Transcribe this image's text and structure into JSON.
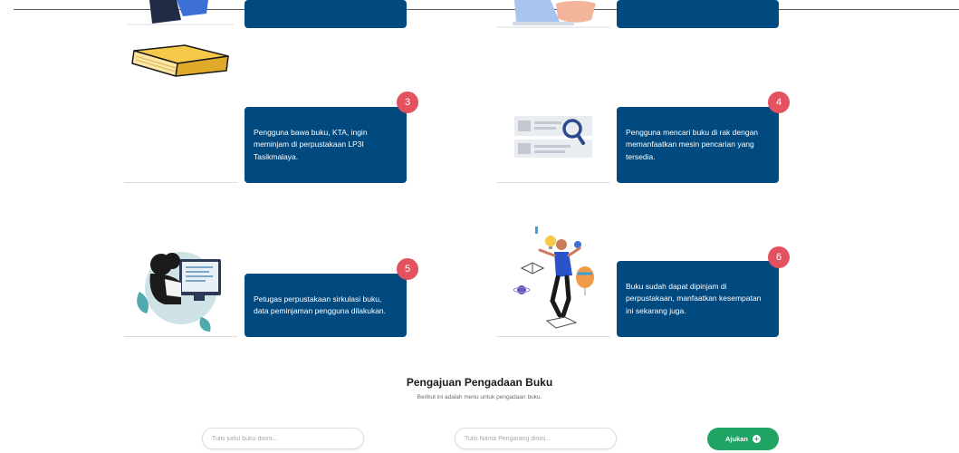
{
  "steps": [
    {
      "number": "3",
      "text": "Pengguna bawa buku, KTA, ingin meminjam di perpustakaan LP3I Tasikmalaya."
    },
    {
      "number": "4",
      "text": "Pengguna mencari buku di rak dengan memanfaatkan mesin pencarian yang tersedia."
    },
    {
      "number": "5",
      "text": "Petugas perpustakaan sirkulasi buku, data peminjaman pengguna dilakukan."
    },
    {
      "number": "6",
      "text": "Buku sudah dapat dipinjam di perpustakaan, manfaatkan kesempatan ini sekarang juga."
    }
  ],
  "procurement": {
    "title": "Pengajuan Pengadaan Buku",
    "subtitle": "Berikut ini adalah menu untuk pengadaan buku.",
    "title_placeholder": "Tulis judul buku disini...",
    "author_placeholder": "Tulis Nama Pengarang disini...",
    "submit_label": "Ajukan"
  },
  "colors": {
    "card": "#004a80",
    "badge": "#e4515f",
    "submit": "#1fa463"
  }
}
